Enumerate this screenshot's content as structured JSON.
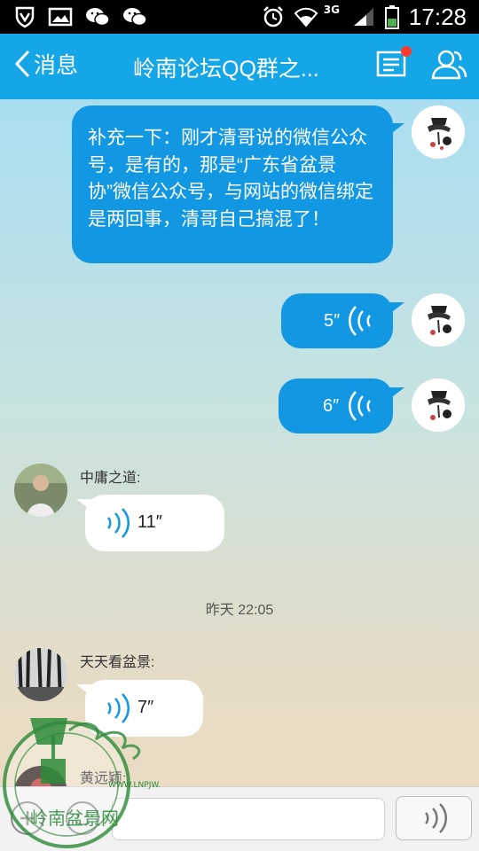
{
  "status_bar": {
    "time": "17:28",
    "network": "3G"
  },
  "header": {
    "back_label": "消息",
    "title": "岭南论坛QQ群之..."
  },
  "messages": [
    {
      "side": "out",
      "text": "补充一下：刚才清哥说的微信公众号，是有的，那是“广东省盆景协”微信公众号，与网站的微信绑定是两回事，清哥自己搞混了！"
    },
    {
      "side": "out",
      "voice_duration": "5″"
    },
    {
      "side": "out",
      "voice_duration": "6″"
    },
    {
      "side": "in",
      "sender": "中庸之道:",
      "voice_duration": "11″"
    },
    {
      "side": "in",
      "sender": "天天看盆景:",
      "voice_duration": "7″"
    },
    {
      "side": "in",
      "sender": "黄远颖:"
    }
  ],
  "time_separator": "昨天 22:05",
  "input": {
    "value": "",
    "placeholder": ""
  },
  "watermark": {
    "text": "岭南盆景网",
    "url": "WWW.LNPJW.COM"
  },
  "colors": {
    "header_bg": "#14a6e6",
    "out_bubble": "#1297e3",
    "in_bubble": "#ffffff",
    "voice_wave": "#1297e3",
    "notification_dot": "#ff3b30"
  }
}
